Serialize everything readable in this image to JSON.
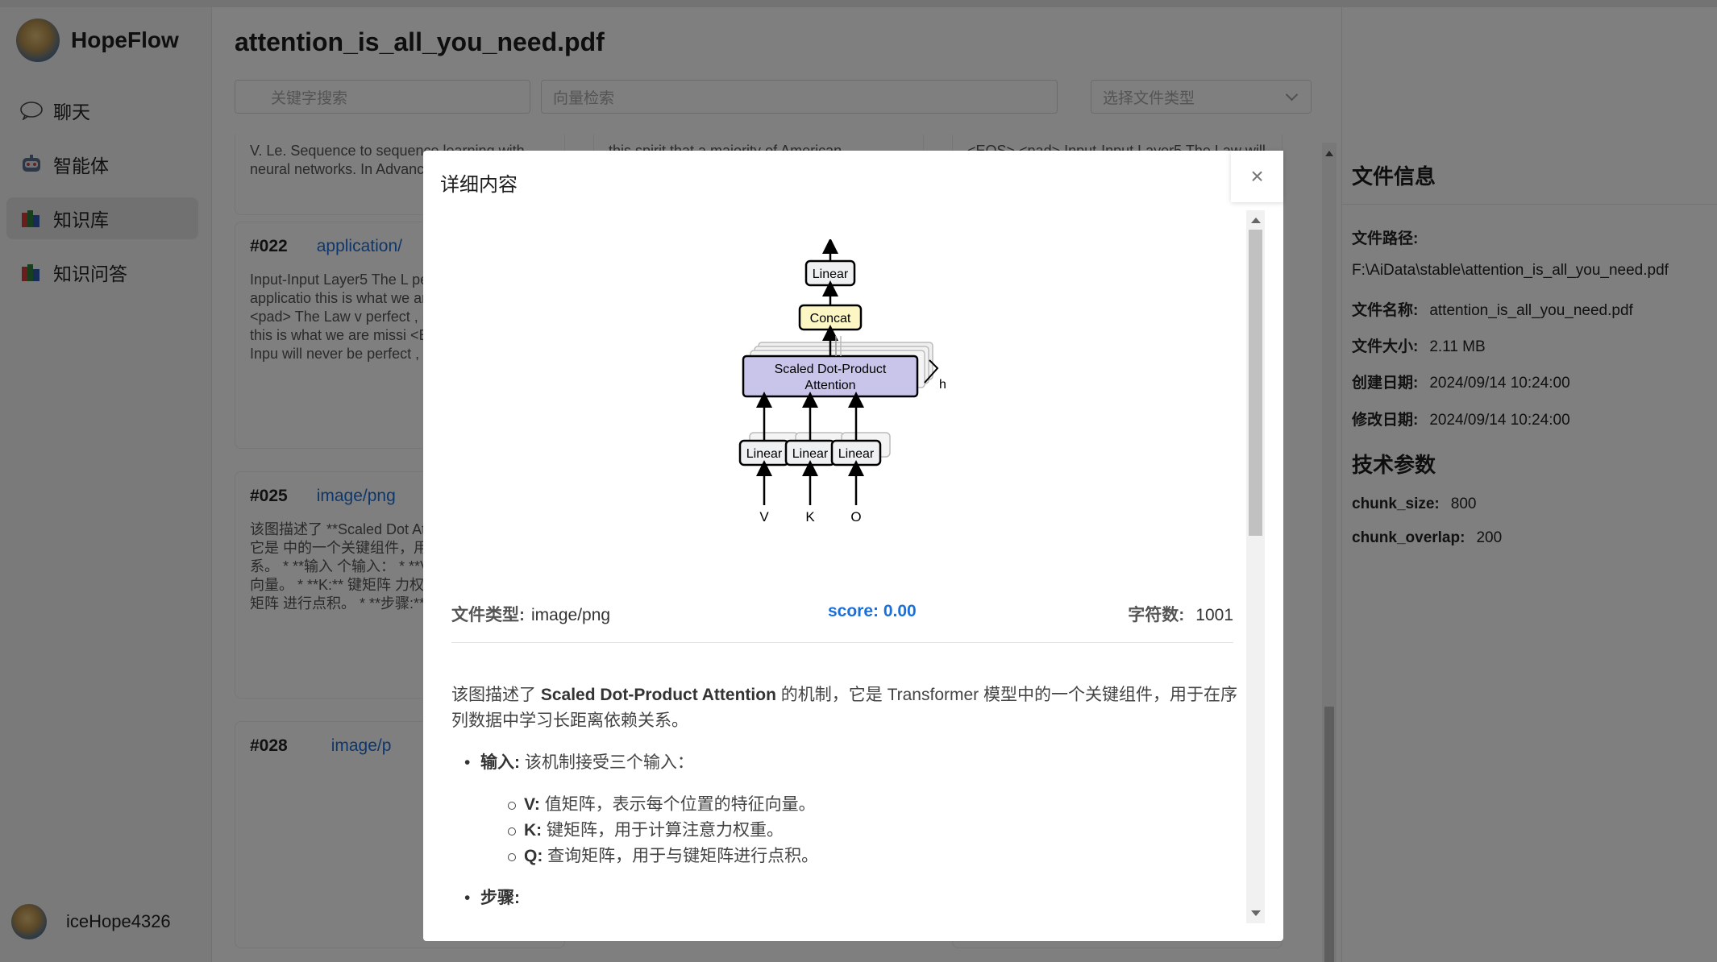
{
  "app": {
    "brand": "HopeFlow",
    "user": "iceHope4326"
  },
  "sidebar": {
    "items": [
      {
        "label": "聊天",
        "icon": "chat-bubble-icon"
      },
      {
        "label": "智能体",
        "icon": "robot-icon"
      },
      {
        "label": "知识库",
        "icon": "books-icon",
        "active": true
      },
      {
        "label": "知识问答",
        "icon": "books-icon"
      }
    ]
  },
  "main": {
    "title": "attention_is_all_you_need.pdf",
    "search_keyword_placeholder": "关键字搜索",
    "search_vector_placeholder": "向量检索",
    "file_type_placeholder": "选择文件类型",
    "cards": [
      {
        "num": "",
        "type": "",
        "body": "V. Le. Sequence to sequence learning with neural networks. In Advances in Neural"
      },
      {
        "num": "",
        "type": "",
        "body": "this spirit that a majority of American governments have passed new laws since"
      },
      {
        "num": "",
        "type": "",
        "body": "<EOS> <pad> Input-Input Layer5 The Law will never be perfect , but its application"
      },
      {
        "num": "#022",
        "type": "application/",
        "body": "Input-Input Layer5 The L perfect , but its applicatio this is what we are missi <EOS> <pad> The Law v perfect , but its applicatio this is what we are missi <EOS> <pad> Input-Inpu will never be perfect , but"
      },
      {
        "num": "#025",
        "type": "image/png",
        "body": "该图描述了 **Scaled Dot Attention** 的机制，它是 中的一个关键组件，用于 长距离依赖关系。 * **输入 个输入： * **V:** 值矩阵， 特征向量。 * **K:** 键矩阵 力权重。 * **Q:** 查询矩阵 进行点积。 * **步骤:** 1."
      },
      {
        "num": "#028",
        "type": "image/p",
        "body": ""
      }
    ]
  },
  "info": {
    "title": "文件信息",
    "path_label": "文件路径:",
    "path": "F:\\AiData\\stable\\attention_is_all_you_need.pdf",
    "name_label": "文件名称:",
    "name": "attention_is_all_you_need.pdf",
    "size_label": "文件大小:",
    "size": "2.11 MB",
    "created_label": "创建日期:",
    "created": "2024/09/14 10:24:00",
    "modified_label": "修改日期:",
    "modified": "2024/09/14 10:24:00",
    "tech_title": "技术参数",
    "chunk_size_label": "chunk_size:",
    "chunk_size": "800",
    "chunk_overlap_label": "chunk_overlap:",
    "chunk_overlap": "200"
  },
  "modal": {
    "title": "详细内容",
    "close": "×",
    "diagram": {
      "linear_top": "Linear",
      "concat": "Concat",
      "sdpa_line1": "Scaled Dot-Product",
      "sdpa_line2": "Attention",
      "h": "h",
      "linear": "Linear",
      "inputs": [
        "V",
        "K",
        "Q"
      ]
    },
    "file_type_label": "文件类型:",
    "file_type": "image/png",
    "score": "score: 0.00",
    "char_count_label": "字符数:",
    "char_count": "1001",
    "para_1": "该图描述了",
    "para_bold": "Scaled Dot-Product Attention",
    "para_2": "的机制，它是 Transformer 模型中的一个关键组件，用于在序列数据中学习长距离依赖关系。",
    "input_label": "输入:",
    "input_text": "该机制接受三个输入：",
    "v_label": "V:",
    "v_text": "值矩阵，表示每个位置的特征向量。",
    "k_label": "K:",
    "k_text": "键矩阵，用于计算注意力权重。",
    "q_label": "Q:",
    "q_text": "查询矩阵，用于与键矩阵进行点积。",
    "steps_label": "步骤:"
  },
  "colors": {
    "accent": "#1a6fd8",
    "sdpa_fill": "#c9c5ea",
    "concat_fill": "#fbf6c4"
  }
}
